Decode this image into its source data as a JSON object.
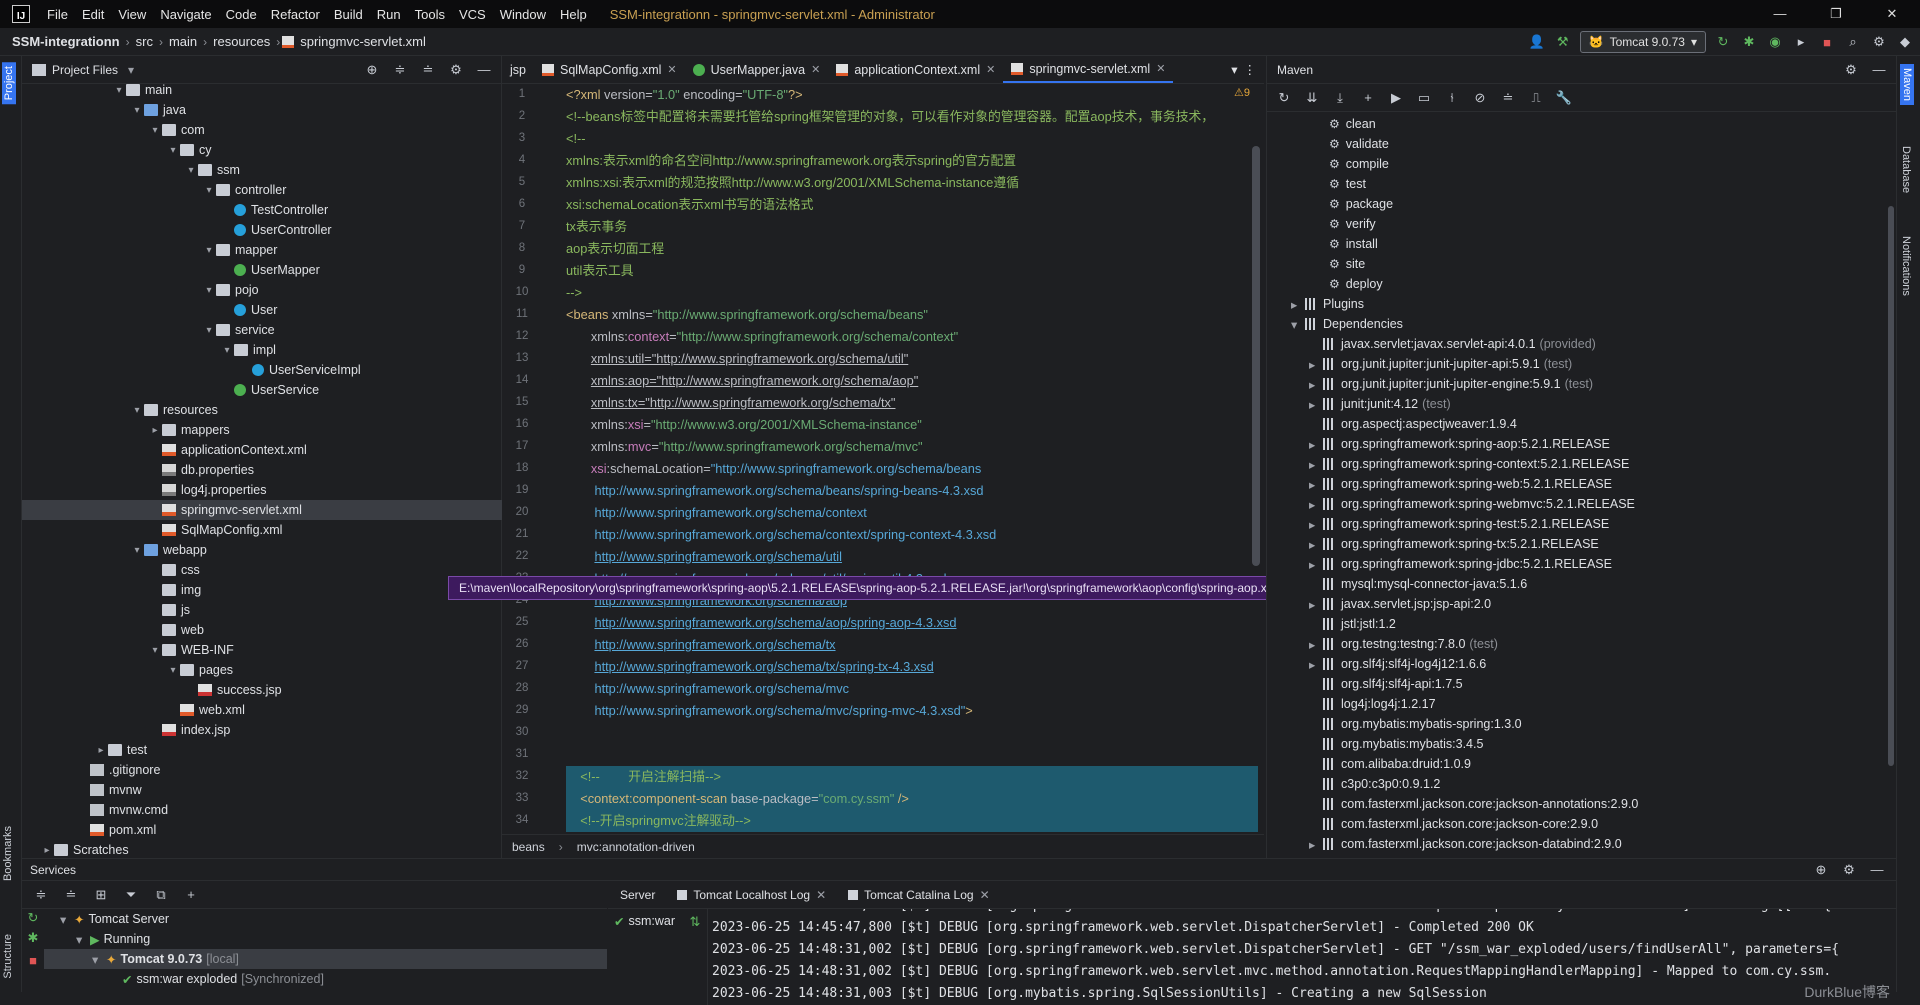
{
  "titlebar": {
    "menu": [
      "File",
      "Edit",
      "View",
      "Navigate",
      "Code",
      "Refactor",
      "Build",
      "Run",
      "Tools",
      "VCS",
      "Window",
      "Help"
    ],
    "title": "SSM-integrationn - springmvc-servlet.xml - Administrator",
    "controls": [
      "—",
      "❐",
      "✕"
    ]
  },
  "navbar": {
    "crumbs": [
      "SSM-integrationn",
      "src",
      "main",
      "resources",
      "springmvc-servlet.xml"
    ],
    "run_config": "Tomcat 9.0.73"
  },
  "leftstrip": {
    "project": "Project",
    "bookmarks": "Bookmarks",
    "structure": "Structure"
  },
  "rightstrip": {
    "maven": "Maven",
    "database": "Database",
    "notifications": "Notifications"
  },
  "project": {
    "header": "Project Files",
    "tree": [
      {
        "label": "main",
        "indent": 5,
        "icon": "fold",
        "arrow": "▾"
      },
      {
        "label": "java",
        "indent": 6,
        "icon": "fold blue",
        "arrow": "▾"
      },
      {
        "label": "com",
        "indent": 7,
        "icon": "fold",
        "arrow": "▾"
      },
      {
        "label": "cy",
        "indent": 8,
        "icon": "fold",
        "arrow": "▾"
      },
      {
        "label": "ssm",
        "indent": 9,
        "icon": "fold",
        "arrow": "▾"
      },
      {
        "label": "controller",
        "indent": 10,
        "icon": "fold",
        "arrow": "▾"
      },
      {
        "label": "TestController",
        "indent": 11,
        "icon": "cls",
        "arrow": ""
      },
      {
        "label": "UserController",
        "indent": 11,
        "icon": "cls",
        "arrow": ""
      },
      {
        "label": "mapper",
        "indent": 10,
        "icon": "fold",
        "arrow": "▾"
      },
      {
        "label": "UserMapper",
        "indent": 11,
        "icon": "intf",
        "arrow": ""
      },
      {
        "label": "pojo",
        "indent": 10,
        "icon": "fold",
        "arrow": "▾"
      },
      {
        "label": "User",
        "indent": 11,
        "icon": "cls",
        "arrow": ""
      },
      {
        "label": "service",
        "indent": 10,
        "icon": "fold",
        "arrow": "▾"
      },
      {
        "label": "impl",
        "indent": 11,
        "icon": "fold",
        "arrow": "▾"
      },
      {
        "label": "UserServiceImpl",
        "indent": 12,
        "icon": "cls",
        "arrow": ""
      },
      {
        "label": "UserService",
        "indent": 11,
        "icon": "intf",
        "arrow": ""
      },
      {
        "label": "resources",
        "indent": 6,
        "icon": "fold",
        "arrow": "▾"
      },
      {
        "label": "mappers",
        "indent": 7,
        "icon": "fold",
        "arrow": "▸"
      },
      {
        "label": "applicationContext.xml",
        "indent": 7,
        "icon": "xml",
        "arrow": ""
      },
      {
        "label": "db.properties",
        "indent": 7,
        "icon": "prop",
        "arrow": ""
      },
      {
        "label": "log4j.properties",
        "indent": 7,
        "icon": "prop",
        "arrow": ""
      },
      {
        "label": "springmvc-servlet.xml",
        "indent": 7,
        "icon": "xml",
        "arrow": "",
        "selected": true
      },
      {
        "label": "SqlMapConfig.xml",
        "indent": 7,
        "icon": "xml",
        "arrow": ""
      },
      {
        "label": "webapp",
        "indent": 6,
        "icon": "fold blue",
        "arrow": "▾"
      },
      {
        "label": "css",
        "indent": 7,
        "icon": "fold",
        "arrow": ""
      },
      {
        "label": "img",
        "indent": 7,
        "icon": "fold",
        "arrow": ""
      },
      {
        "label": "js",
        "indent": 7,
        "icon": "fold",
        "arrow": ""
      },
      {
        "label": "web",
        "indent": 7,
        "icon": "fold",
        "arrow": ""
      },
      {
        "label": "WEB-INF",
        "indent": 7,
        "icon": "fold",
        "arrow": "▾"
      },
      {
        "label": "pages",
        "indent": 8,
        "icon": "fold",
        "arrow": "▾"
      },
      {
        "label": "success.jsp",
        "indent": 9,
        "icon": "jsp",
        "arrow": ""
      },
      {
        "label": "web.xml",
        "indent": 8,
        "icon": "xml",
        "arrow": ""
      },
      {
        "label": "index.jsp",
        "indent": 7,
        "icon": "jsp",
        "arrow": ""
      },
      {
        "label": "test",
        "indent": 4,
        "icon": "fold",
        "arrow": "▸"
      },
      {
        "label": ".gitignore",
        "indent": 3,
        "icon": "file",
        "arrow": ""
      },
      {
        "label": "mvnw",
        "indent": 3,
        "icon": "file",
        "arrow": ""
      },
      {
        "label": "mvnw.cmd",
        "indent": 3,
        "icon": "file",
        "arrow": ""
      },
      {
        "label": "pom.xml",
        "indent": 3,
        "icon": "xml",
        "arrow": ""
      },
      {
        "label": "Scratches",
        "indent": 1,
        "icon": "fold",
        "arrow": "▸"
      }
    ]
  },
  "editor": {
    "tabs": [
      {
        "label": "jsp",
        "close": false
      },
      {
        "label": "SqlMapConfig.xml",
        "close": true
      },
      {
        "label": "UserMapper.java",
        "close": true
      },
      {
        "label": "applicationContext.xml",
        "close": true
      },
      {
        "label": "springmvc-servlet.xml",
        "close": true,
        "active": true
      }
    ],
    "warnings": "⚠9",
    "lines": [
      {
        "n": "1",
        "html": "<span class='c-tag'>&lt;?xml</span> version=<span class='c-str'>\"1.0\"</span> encoding=<span class='c-str'>\"UTF-8\"</span><span class='c-tag'>?&gt;</span>"
      },
      {
        "n": "2",
        "html": "<span class='c-cmt'>&lt;!--beans标签中配置将未需要托管给spring框架管理的对象，可以看作对象的管理容器。配置aop技术，事务技术，</span>"
      },
      {
        "n": "3",
        "html": "<span class='c-cmt'>&lt;!--</span>"
      },
      {
        "n": "4",
        "html": "<span class='c-cmt'>xmlns:表示xml的命名空间http://www.springframework.org表示spring的官方配置</span>"
      },
      {
        "n": "5",
        "html": "<span class='c-cmt'>xmlns:xsi:表示xml的规范按照http://www.w3.org/2001/XMLSchema-instance遵循</span>"
      },
      {
        "n": "6",
        "html": "<span class='c-cmt'>xsi:schemaLocation表示xml书写的语法格式</span>"
      },
      {
        "n": "7",
        "html": "<span class='c-cmt'>tx表示事务</span>"
      },
      {
        "n": "8",
        "html": "<span class='c-cmt'>aop表示切面工程</span>"
      },
      {
        "n": "9",
        "html": "<span class='c-cmt'>util表示工具</span>"
      },
      {
        "n": "10",
        "html": "<span class='c-cmt'>--&gt;</span>"
      },
      {
        "n": "11",
        "html": "<span class='c-tag'>&lt;beans</span> xmlns=<span class='c-str'>\"http://www.springframework.org/schema/beans\"</span>"
      },
      {
        "n": "12",
        "html": "       xmlns:<span class='c-ns'>context</span>=<span class='c-str'>\"http://www.springframework.org/schema/context\"</span>"
      },
      {
        "n": "13",
        "html": "       <u>xmlns:util=\"http://www.springframework.org/schema/util\"</u>"
      },
      {
        "n": "14",
        "html": "       <u>xmlns:aop=\"http://www.springframework.org/schema/aop\"</u>"
      },
      {
        "n": "15",
        "html": "       <u>xmlns:tx=\"http://www.springframework.org/schema/tx\"</u>"
      },
      {
        "n": "16",
        "html": "       xmlns:<span class='c-ns'>xsi</span>=<span class='c-str'>\"http://www.w3.org/2001/XMLSchema-instance\"</span>"
      },
      {
        "n": "17",
        "html": "       xmlns:<span class='c-ns'>mvc</span>=<span class='c-str'>\"http://www.springframework.org/schema/mvc\"</span>"
      },
      {
        "n": "18",
        "html": "       <span class='c-ns'>xsi</span>:schemaLocation=<span class='c-url'>\"http://www.springframework.org/schema/beans</span>"
      },
      {
        "n": "19",
        "html": "        <span class='c-url'>http://www.springframework.org/schema/beans/spring-beans-4.3.xsd</span>"
      },
      {
        "n": "20",
        "html": "        <span class='c-url'>http://www.springframework.org/schema/context</span>"
      },
      {
        "n": "21",
        "html": "        <span class='c-url'>http://www.springframework.org/schema/context/spring-context-4.3.xsd</span>"
      },
      {
        "n": "22",
        "html": "        <span class='c-url'><u>http://www.springframework.org/schema/util</u></span>"
      },
      {
        "n": "23",
        "html": "        <span class='c-url'>http://www.springframework.org/schema/util/spring-util-4.3.xsd</span>"
      },
      {
        "n": "24",
        "html": "        <span class='c-url'><u>http://www.springframework.org/schema/aop</u></span>"
      },
      {
        "n": "25",
        "html": "        <span class='c-url'><u>http://www.springframework.org/schema/aop/spring-aop-4.3.xsd</u></span>"
      },
      {
        "n": "26",
        "html": "        <span class='c-url'><u>http://www.springframework.org/schema/tx</u></span>"
      },
      {
        "n": "27",
        "html": "        <span class='c-url'><u>http://www.springframework.org/schema/tx/spring-tx-4.3.xsd</u></span>"
      },
      {
        "n": "28",
        "html": "        <span class='c-url'>http://www.springframework.org/schema/mvc</span>"
      },
      {
        "n": "29",
        "html": "        <span class='c-url'>http://www.springframework.org/schema/mvc/spring-mvc-4.3.xsd\"</span><span class='c-tag'>&gt;</span>"
      },
      {
        "n": "30",
        "html": ""
      },
      {
        "n": "31",
        "html": ""
      },
      {
        "n": "32",
        "html": "    <span class='c-cmt'>&lt;!--        开启注解扫描--&gt;</span>",
        "hl": true
      },
      {
        "n": "33",
        "html": "    <span class='c-tag'>&lt;context:component-scan</span> base-package=<span class='c-str'>\"com.cy.ssm\"</span> <span class='c-tag'>/&gt;</span>",
        "hl": true
      },
      {
        "n": "34",
        "html": "    <span class='c-cmt'>&lt;!--开启springmvc注解驱动--&gt;</span>",
        "hl": true
      }
    ],
    "footer": [
      "beans",
      "mvc:annotation-driven"
    ]
  },
  "tooltip": "E:\\maven\\localRepository\\org\\springframework\\spring-aop\\5.2.1.RELEASE\\spring-aop-5.2.1.RELEASE.jar!\\org\\springframework\\aop\\config\\spring-aop.xsd",
  "maven": {
    "header": "Maven",
    "lifecycle": [
      "clean",
      "validate",
      "compile",
      "test",
      "package",
      "verify",
      "install",
      "site",
      "deploy"
    ],
    "plugins": "Plugins",
    "dependencies": "Dependencies",
    "deps": [
      {
        "name": "javax.servlet:javax.servlet-api:4.0.1",
        "scope": "(provided)",
        "arrow": ""
      },
      {
        "name": "org.junit.jupiter:junit-jupiter-api:5.9.1",
        "scope": "(test)",
        "arrow": "▸"
      },
      {
        "name": "org.junit.jupiter:junit-jupiter-engine:5.9.1",
        "scope": "(test)",
        "arrow": "▸"
      },
      {
        "name": "junit:junit:4.12",
        "scope": "(test)",
        "arrow": "▸"
      },
      {
        "name": "org.aspectj:aspectjweaver:1.9.4",
        "scope": "",
        "arrow": ""
      },
      {
        "name": "org.springframework:spring-aop:5.2.1.RELEASE",
        "scope": "",
        "arrow": "▸"
      },
      {
        "name": "org.springframework:spring-context:5.2.1.RELEASE",
        "scope": "",
        "arrow": "▸"
      },
      {
        "name": "org.springframework:spring-web:5.2.1.RELEASE",
        "scope": "",
        "arrow": "▸"
      },
      {
        "name": "org.springframework:spring-webmvc:5.2.1.RELEASE",
        "scope": "",
        "arrow": "▸"
      },
      {
        "name": "org.springframework:spring-test:5.2.1.RELEASE",
        "scope": "",
        "arrow": "▸"
      },
      {
        "name": "org.springframework:spring-tx:5.2.1.RELEASE",
        "scope": "",
        "arrow": "▸"
      },
      {
        "name": "org.springframework:spring-jdbc:5.2.1.RELEASE",
        "scope": "",
        "arrow": "▸"
      },
      {
        "name": "mysql:mysql-connector-java:5.1.6",
        "scope": "",
        "arrow": ""
      },
      {
        "name": "javax.servlet.jsp:jsp-api:2.0",
        "scope": "",
        "arrow": "▸"
      },
      {
        "name": "jstl:jstl:1.2",
        "scope": "",
        "arrow": ""
      },
      {
        "name": "org.testng:testng:7.8.0",
        "scope": "(test)",
        "arrow": "▸"
      },
      {
        "name": "org.slf4j:slf4j-log4j12:1.6.6",
        "scope": "",
        "arrow": "▸"
      },
      {
        "name": "org.slf4j:slf4j-api:1.7.5",
        "scope": "",
        "arrow": ""
      },
      {
        "name": "log4j:log4j:1.2.17",
        "scope": "",
        "arrow": ""
      },
      {
        "name": "org.mybatis:mybatis-spring:1.3.0",
        "scope": "",
        "arrow": ""
      },
      {
        "name": "org.mybatis:mybatis:3.4.5",
        "scope": "",
        "arrow": ""
      },
      {
        "name": "com.alibaba:druid:1.0.9",
        "scope": "",
        "arrow": ""
      },
      {
        "name": "c3p0:c3p0:0.9.1.2",
        "scope": "",
        "arrow": ""
      },
      {
        "name": "com.fasterxml.jackson.core:jackson-annotations:2.9.0",
        "scope": "",
        "arrow": ""
      },
      {
        "name": "com.fasterxml.jackson.core:jackson-core:2.9.0",
        "scope": "",
        "arrow": ""
      },
      {
        "name": "com.fasterxml.jackson.core:jackson-databind:2.9.0",
        "scope": "",
        "arrow": "▸"
      }
    ]
  },
  "services": {
    "header": "Services",
    "tree": [
      {
        "label": "Tomcat Server",
        "indent": 1,
        "arrow": "▾",
        "dim": ""
      },
      {
        "label": "Running",
        "indent": 2,
        "arrow": "▾",
        "dim": ""
      },
      {
        "label": "Tomcat 9.0.73",
        "indent": 3,
        "arrow": "▾",
        "dim": "[local]",
        "selected": true
      },
      {
        "label": "ssm:war exploded",
        "indent": 4,
        "arrow": "",
        "dim": "[Synchronized]"
      }
    ],
    "tabs": [
      "Server",
      "Tomcat Localhost Log",
      "Tomcat Catalina Log"
    ],
    "deploy_item": "ssm:war",
    "log": [
      "2023-06-25 14:45:47,800 [$t] DEBUG [org.springframework.web.servlet.mvc.method.annotation.RequestResponseBodyMethodProcessor] - Writing [[User{i",
      "2023-06-25 14:45:47,800 [$t] DEBUG [org.springframework.web.servlet.DispatcherServlet] - Completed 200 OK",
      "2023-06-25 14:48:31,002 [$t] DEBUG [org.springframework.web.servlet.DispatcherServlet] - GET \"/ssm_war_exploded/users/findUserAll\", parameters={",
      "2023-06-25 14:48:31,002 [$t] DEBUG [org.springframework.web.servlet.mvc.method.annotation.RequestMappingHandlerMapping] - Mapped to com.cy.ssm.",
      "2023-06-25 14:48:31,003 [$t] DEBUG [org.mybatis.spring.SqlSessionUtils] - Creating a new SqlSession"
    ]
  },
  "watermark": "DurkBlue博客"
}
